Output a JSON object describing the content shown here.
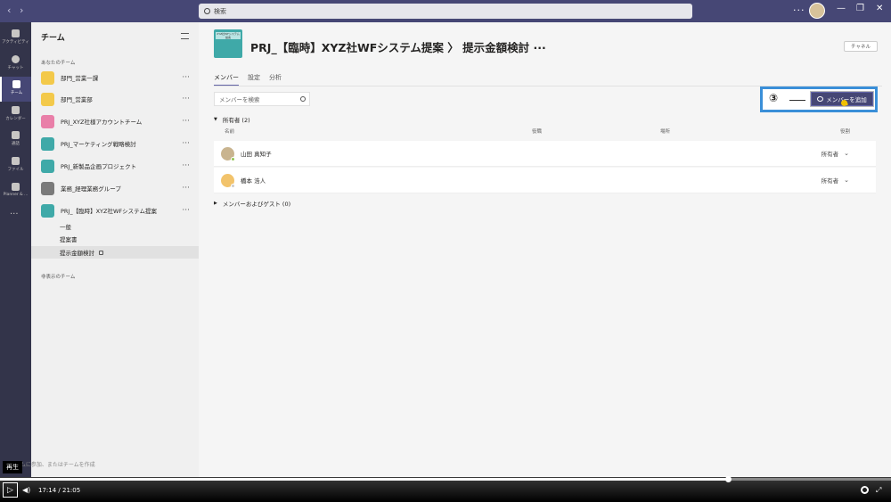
{
  "search": {
    "placeholder": "検索"
  },
  "rail": {
    "items": [
      {
        "label": "アクティビティ"
      },
      {
        "label": "チャット"
      },
      {
        "label": "チーム"
      },
      {
        "label": "カレンダー"
      },
      {
        "label": "通話"
      },
      {
        "label": "ファイル"
      },
      {
        "label": "Planner & ..."
      }
    ],
    "more": "···"
  },
  "panel": {
    "title": "チーム",
    "your_teams_label": "あなたのチーム",
    "hidden_teams_label": "非表示のチーム",
    "create_label": "チームに参加、またはチームを作成",
    "teams": [
      {
        "name": "部門_営業一課",
        "logo_color": "#f3c94a"
      },
      {
        "name": "部門_営業部",
        "logo_color": "#f3c94a"
      },
      {
        "name": "PRJ_XYZ社様アカウントチーム",
        "logo_color": "#e97fa8"
      },
      {
        "name": "PRJ_マーケティング戦略検討",
        "logo_color": "#3fa9a8"
      },
      {
        "name": "PRJ_新製品企画プロジェクト",
        "logo_color": "#3fa9a8"
      },
      {
        "name": "業務_経理業務グループ",
        "logo_color": "#7a7a7a"
      },
      {
        "name": "PRJ_【臨時】XYZ社WFシステム提案",
        "logo_color": "#3fa9a8"
      }
    ],
    "channels": [
      "一般",
      "提案書",
      "提示金額検討"
    ]
  },
  "header": {
    "logo_text": "XYZ社WFシステム提案",
    "title": "PRJ_【臨時】XYZ社WFシステム提案 〉 提示金額検討 ···",
    "channel_button": "チャネル"
  },
  "tabs": [
    "メンバー",
    "設定",
    "分析"
  ],
  "member_search": {
    "placeholder": "メンバーを検索"
  },
  "callout": {
    "number": "③",
    "button_label": "メンバーを追加"
  },
  "owners": {
    "label": "所有者 (2)"
  },
  "columns": {
    "name": "名前",
    "title": "役職",
    "location": "場所",
    "role": "役割"
  },
  "members": [
    {
      "name": "山田 真知子",
      "role": "所有者",
      "avatar_color": "#c9b48f",
      "status_color": "#92c353"
    },
    {
      "name": "橋本 浩人",
      "role": "所有者",
      "avatar_color": "#f2c36b",
      "status_color": "#cccccc"
    }
  ],
  "guests": {
    "label": "メンバーおよびゲスト (0)"
  },
  "video": {
    "tooltip": "再生",
    "current": "17:14",
    "total": "21:05",
    "progress": 0.817
  }
}
